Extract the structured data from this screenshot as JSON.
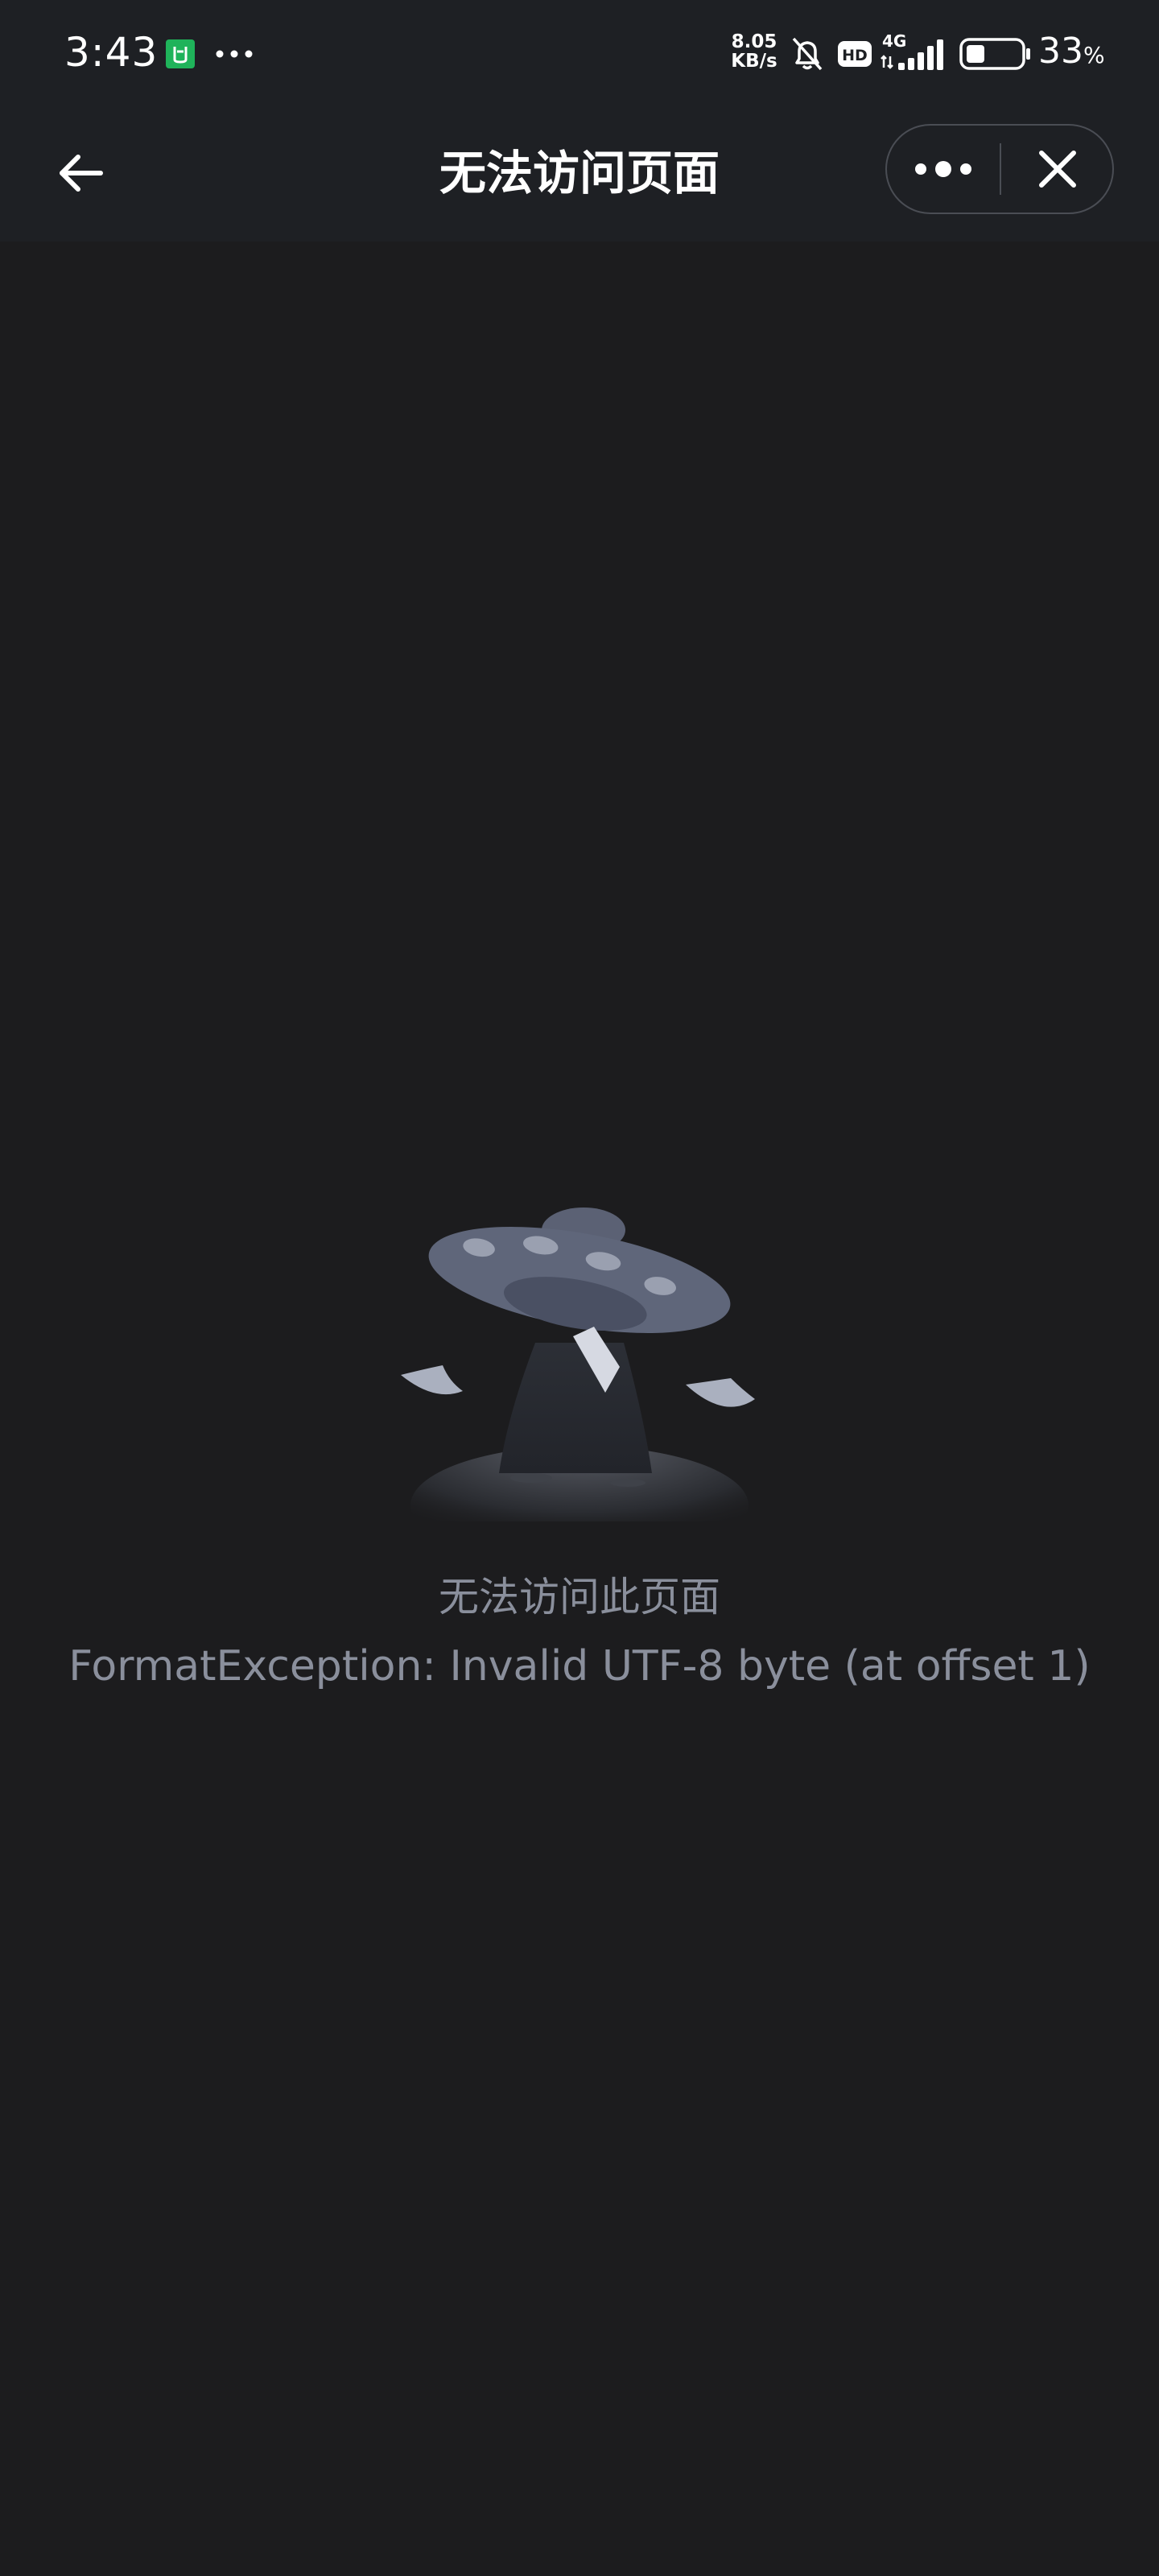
{
  "status_bar": {
    "time": "3:43",
    "net_speed_value": "8.05",
    "net_speed_unit": "KB/s",
    "network_type": "4G",
    "hd_label": "HD",
    "battery_percent": "33",
    "battery_unit": "%",
    "icons": [
      "app-notification-icon",
      "more-notifications-icon",
      "bell-off-icon",
      "hd-icon",
      "signal-icon",
      "battery-icon"
    ]
  },
  "nav": {
    "title": "无法访问页面",
    "back_icon": "arrow-left-icon",
    "more_icon": "more-dots-icon",
    "close_icon": "close-icon"
  },
  "error": {
    "illustration": "ufo-illustration",
    "title": "无法访问此页面",
    "detail": "FormatException: Invalid UTF-8 byte (at offset 1)"
  },
  "colors": {
    "background": "#1c1c1e",
    "header": "#1e2024",
    "muted_text": "#8a8f9c",
    "app_badge_green": "#1fb35a"
  }
}
